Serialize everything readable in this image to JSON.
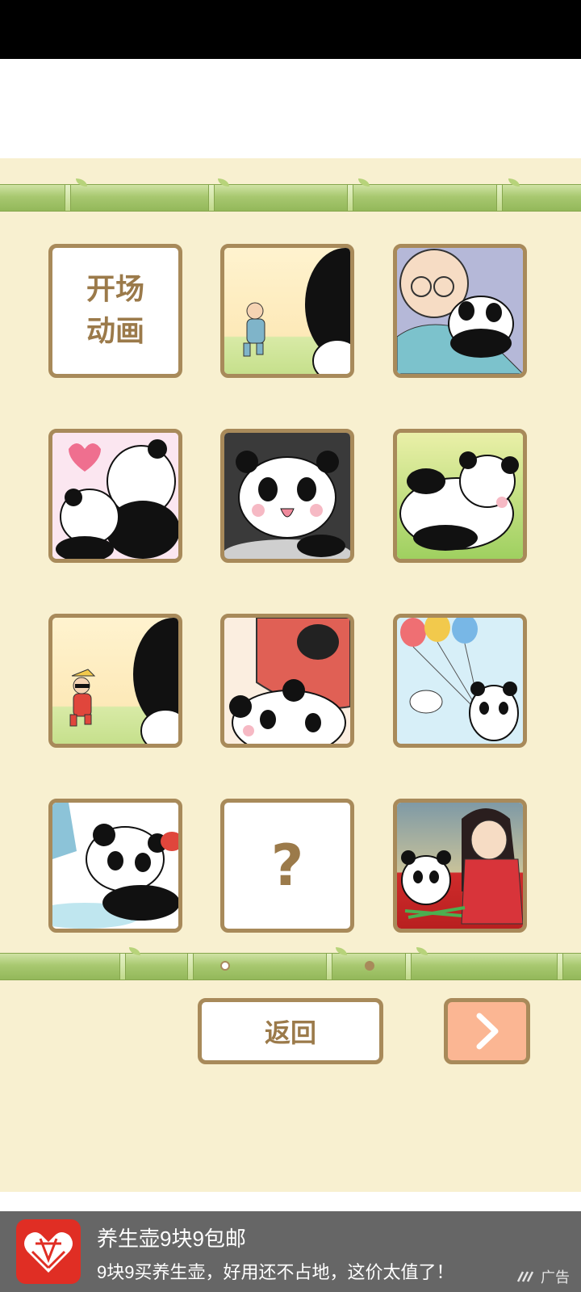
{
  "tiles": [
    {
      "label": "开场\n动画",
      "scene": "opening",
      "locked": false
    },
    {
      "label": "",
      "scene": "old-man-waving-panda",
      "locked": false
    },
    {
      "label": "",
      "scene": "old-man-hugging-panda",
      "locked": false
    },
    {
      "label": "",
      "scene": "pandas-heart",
      "locked": false
    },
    {
      "label": "",
      "scene": "panda-surprised",
      "locked": false
    },
    {
      "label": "",
      "scene": "panda-lying-grass",
      "locked": false
    },
    {
      "label": "",
      "scene": "sunglasses-man-waving-panda",
      "locked": false
    },
    {
      "label": "",
      "scene": "panda-with-red-person",
      "locked": false
    },
    {
      "label": "",
      "scene": "panda-with-balloons",
      "locked": false
    },
    {
      "label": "",
      "scene": "panda-sliding-ice",
      "locked": false
    },
    {
      "label": "?",
      "scene": "locked",
      "locked": true
    },
    {
      "label": "",
      "scene": "kimono-girl-panda-bamboo",
      "locked": false
    }
  ],
  "pagination": {
    "current": 1,
    "total": 2
  },
  "buttons": {
    "back_label": "返回",
    "next_icon": "chevron-right-icon"
  },
  "ad": {
    "title": "养生壶9块9包邮",
    "description": "9块9买养生壶，好用还不占地，这价太值了！",
    "tag": "广告",
    "logo_icon": "pinduoduo-logo"
  },
  "colors": {
    "background": "#f8f0d0",
    "tile_border": "#a88a5a",
    "text": "#9b7a4a",
    "next_button": "#fbb693",
    "ad_bar": "#666666"
  }
}
